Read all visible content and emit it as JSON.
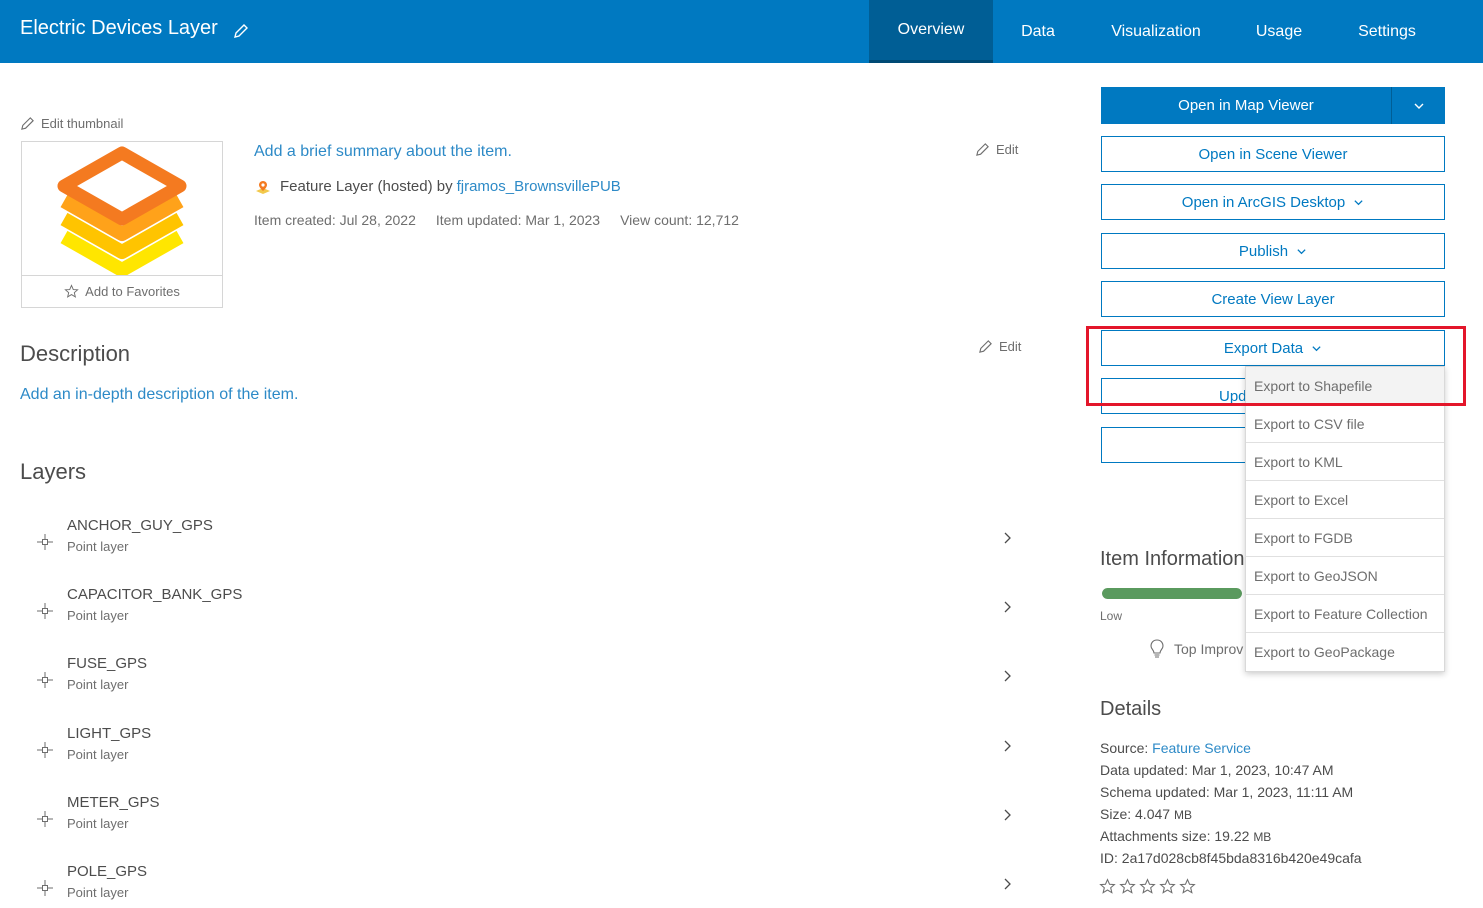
{
  "header": {
    "title": "Electric Devices Layer",
    "tabs": [
      {
        "label": "Overview",
        "active": true
      },
      {
        "label": "Data",
        "active": false
      },
      {
        "label": "Visualization",
        "active": false
      },
      {
        "label": "Usage",
        "active": false
      },
      {
        "label": "Settings",
        "active": false
      }
    ]
  },
  "thumbnail": {
    "edit_label": "Edit thumbnail",
    "favorites_label": "Add to Favorites"
  },
  "summary": {
    "add_summary": "Add a brief summary about the item.",
    "edit_label": "Edit",
    "type_text": "Feature Layer (hosted) by",
    "owner": "fjramos_BrownsvillePUB",
    "created": "Item created: Jul 28, 2022",
    "updated": "Item updated: Mar 1, 2023",
    "view_count": "View count: 12,712"
  },
  "description": {
    "title": "Description",
    "edit_label": "Edit",
    "add_description": "Add an in-depth description of the item."
  },
  "layers": {
    "title": "Layers",
    "items": [
      {
        "name": "ANCHOR_GUY_GPS",
        "type": "Point layer"
      },
      {
        "name": "CAPACITOR_BANK_GPS",
        "type": "Point layer"
      },
      {
        "name": "FUSE_GPS",
        "type": "Point layer"
      },
      {
        "name": "LIGHT_GPS",
        "type": "Point layer"
      },
      {
        "name": "METER_GPS",
        "type": "Point layer"
      },
      {
        "name": "POLE_GPS",
        "type": "Point layer"
      }
    ]
  },
  "actions": {
    "open_map_viewer": "Open in Map Viewer",
    "open_scene_viewer": "Open in Scene Viewer",
    "open_arcgis_desktop": "Open in ArcGIS Desktop",
    "publish": "Publish",
    "create_view_layer": "Create View Layer",
    "export_data": "Export Data",
    "partial_button": "Upd"
  },
  "export_menu": {
    "items": [
      "Export to Shapefile",
      "Export to CSV file",
      "Export to KML",
      "Export to Excel",
      "Export to FGDB",
      "Export to GeoJSON",
      "Export to Feature Collection",
      "Export to GeoPackage"
    ]
  },
  "item_information": {
    "title": "Item Information",
    "level_label": "Low",
    "tip": "Top Improv",
    "progress_fraction": 1.0,
    "bar_color": "#5a9a5e"
  },
  "details": {
    "title": "Details",
    "source_label": "Source:",
    "source_value": "Feature Service",
    "data_updated": "Data updated: Mar 1, 2023, 10:47 AM",
    "schema_updated": "Schema updated: Mar 1, 2023, 11:11 AM",
    "size": "Size: 4.047",
    "size_unit": "MB",
    "attachments_size": "Attachments size: 19.22",
    "attachments_unit": "MB",
    "id": "ID: 2a17d028cb8f45bda8316b420e49cafa"
  },
  "colors": {
    "brand": "#0079c1",
    "link": "#2d8ac7",
    "highlight": "#e3162a"
  }
}
